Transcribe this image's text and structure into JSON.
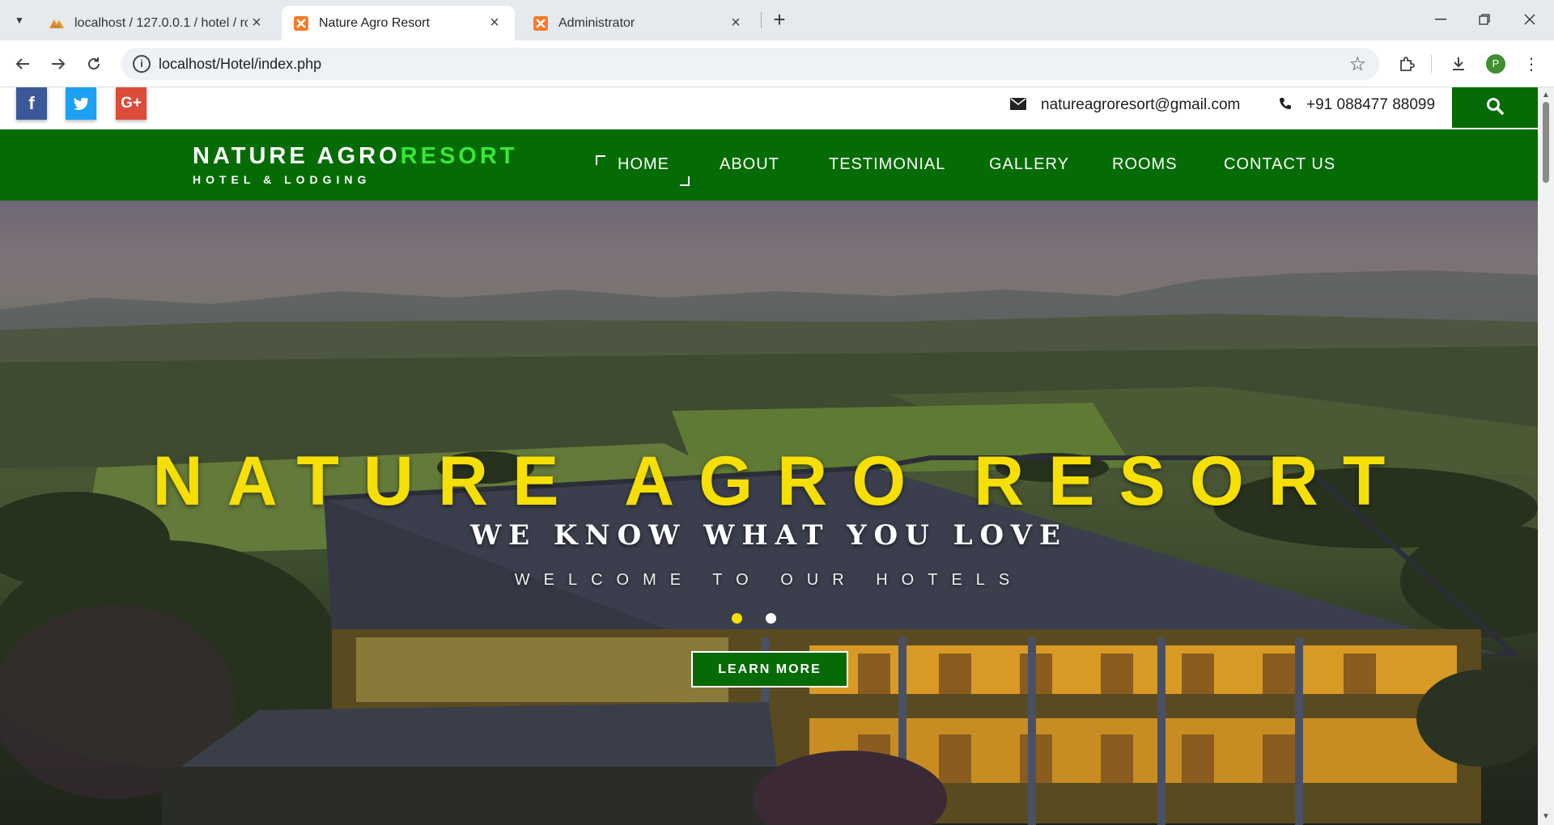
{
  "browser": {
    "tabs": [
      {
        "title": "localhost / 127.0.0.1 / hotel / ro",
        "favicon": "phpmyadmin-icon"
      },
      {
        "title": "Nature Agro Resort",
        "favicon": "xampp-icon",
        "active": true
      },
      {
        "title": "Administrator",
        "favicon": "xampp-icon"
      }
    ],
    "url": "localhost/Hotel/index.php",
    "profile_initial": "P"
  },
  "site": {
    "social": [
      {
        "name": "facebook",
        "glyph": "f",
        "color": "#3b5998"
      },
      {
        "name": "twitter",
        "glyph": "t",
        "color": "#1da1f2"
      },
      {
        "name": "google-plus",
        "glyph": "G+",
        "color": "#dd4b39"
      }
    ],
    "email": "natureagroresort@gmail.com",
    "phone": "+91 088477 88099",
    "brand": {
      "part1": "NATURE AGRO",
      "part2": "RESORT",
      "tagline": "HOTEL & LODGING"
    },
    "menu": [
      "HOME",
      "ABOUT",
      "TESTIMONIAL",
      "GALLERY",
      "ROOMS",
      "CONTACT US"
    ],
    "colors": {
      "nav_green": "#056c05",
      "accent_green": "#39e639",
      "title_yellow": "#f5df05"
    }
  },
  "hero": {
    "title": "NATURE AGRO RESORT",
    "subtitle": "WE KNOW WHAT YOU LOVE",
    "welcome": "WELCOME TO OUR HOTELS",
    "button": "LEARN MORE",
    "slide_count": 2,
    "active_slide": 1
  }
}
